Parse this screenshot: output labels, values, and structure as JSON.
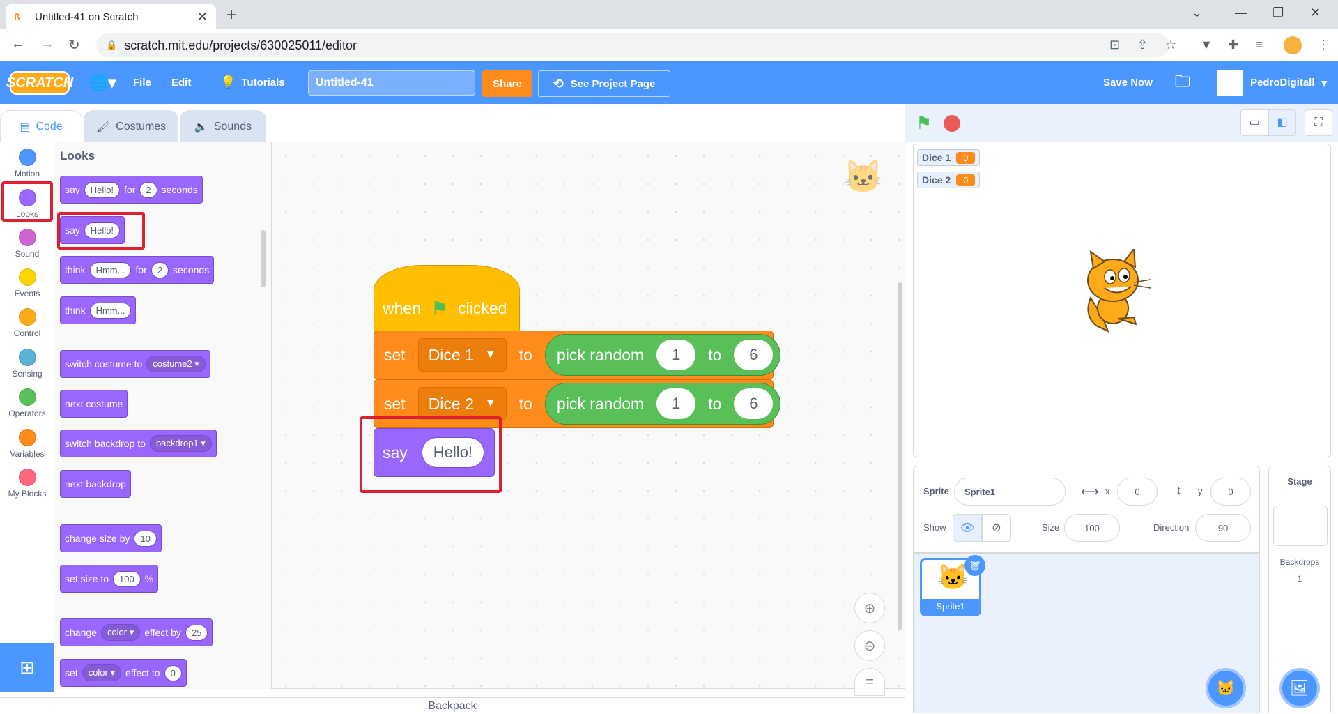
{
  "browser": {
    "tab_title": "Untitled-41 on Scratch",
    "url": "scratch.mit.edu/projects/630025011/editor"
  },
  "menubar": {
    "logo": "SCRATCH",
    "file": "File",
    "edit": "Edit",
    "tutorials": "Tutorials",
    "project_title": "Untitled-41",
    "share": "Share",
    "see_project_page": "See Project Page",
    "save_now": "Save Now",
    "username": "PedroDigitall"
  },
  "editor_tabs": {
    "code": "Code",
    "costumes": "Costumes",
    "sounds": "Sounds"
  },
  "categories": [
    {
      "label": "Motion",
      "color": "#4c97ff"
    },
    {
      "label": "Looks",
      "color": "#9966ff"
    },
    {
      "label": "Sound",
      "color": "#cf63cf"
    },
    {
      "label": "Events",
      "color": "#ffd500"
    },
    {
      "label": "Control",
      "color": "#ffab19"
    },
    {
      "label": "Sensing",
      "color": "#5cb1d6"
    },
    {
      "label": "Operators",
      "color": "#59c059"
    },
    {
      "label": "Variables",
      "color": "#ff8c1a"
    },
    {
      "label": "My Blocks",
      "color": "#ff6680"
    }
  ],
  "palette": {
    "title": "Looks",
    "b1": {
      "say": "say",
      "msg": "Hello!",
      "for": "for",
      "n": "2",
      "seconds": "seconds"
    },
    "b2": {
      "say": "say",
      "msg": "Hello!"
    },
    "b3": {
      "think": "think",
      "msg": "Hmm...",
      "for": "for",
      "n": "2",
      "seconds": "seconds"
    },
    "b4": {
      "think": "think",
      "msg": "Hmm..."
    },
    "b5": {
      "text": "switch costume to",
      "dd": "costume2"
    },
    "b6": {
      "text": "next costume"
    },
    "b7": {
      "text": "switch backdrop to",
      "dd": "backdrop1"
    },
    "b8": {
      "text": "next backdrop"
    },
    "b9": {
      "text": "change size by",
      "n": "10"
    },
    "b10": {
      "text": "set size to",
      "n": "100",
      "unit": "%"
    },
    "b11": {
      "change": "change",
      "dd": "color",
      "effect": "effect by",
      "n": "25"
    },
    "b12": {
      "set": "set",
      "dd": "color",
      "effect": "effect to",
      "n": "0"
    }
  },
  "script": {
    "hat": {
      "when": "when",
      "clicked": "clicked"
    },
    "set1": {
      "set": "set",
      "var": "Dice 1",
      "to": "to",
      "op": "pick random",
      "a": "1",
      "to2": "to",
      "b": "6"
    },
    "set2": {
      "set": "set",
      "var": "Dice 2",
      "to": "to",
      "op": "pick random",
      "a": "1",
      "to2": "to",
      "b": "6"
    },
    "say": {
      "say": "say",
      "msg": "Hello!"
    }
  },
  "workspace": {
    "backpack": "Backpack"
  },
  "stage": {
    "monitors": [
      {
        "name": "Dice 1",
        "value": "0"
      },
      {
        "name": "Dice 2",
        "value": "0"
      }
    ]
  },
  "sprite_info": {
    "sprite_label": "Sprite",
    "sprite_name": "Sprite1",
    "x_label": "x",
    "x": "0",
    "y_label": "y",
    "y": "0",
    "show_label": "Show",
    "size_label": "Size",
    "size": "100",
    "direction_label": "Direction",
    "direction": "90",
    "tile_name": "Sprite1"
  },
  "stage_panel": {
    "title": "Stage",
    "backdrops_label": "Backdrops",
    "backdrops_count": "1"
  }
}
